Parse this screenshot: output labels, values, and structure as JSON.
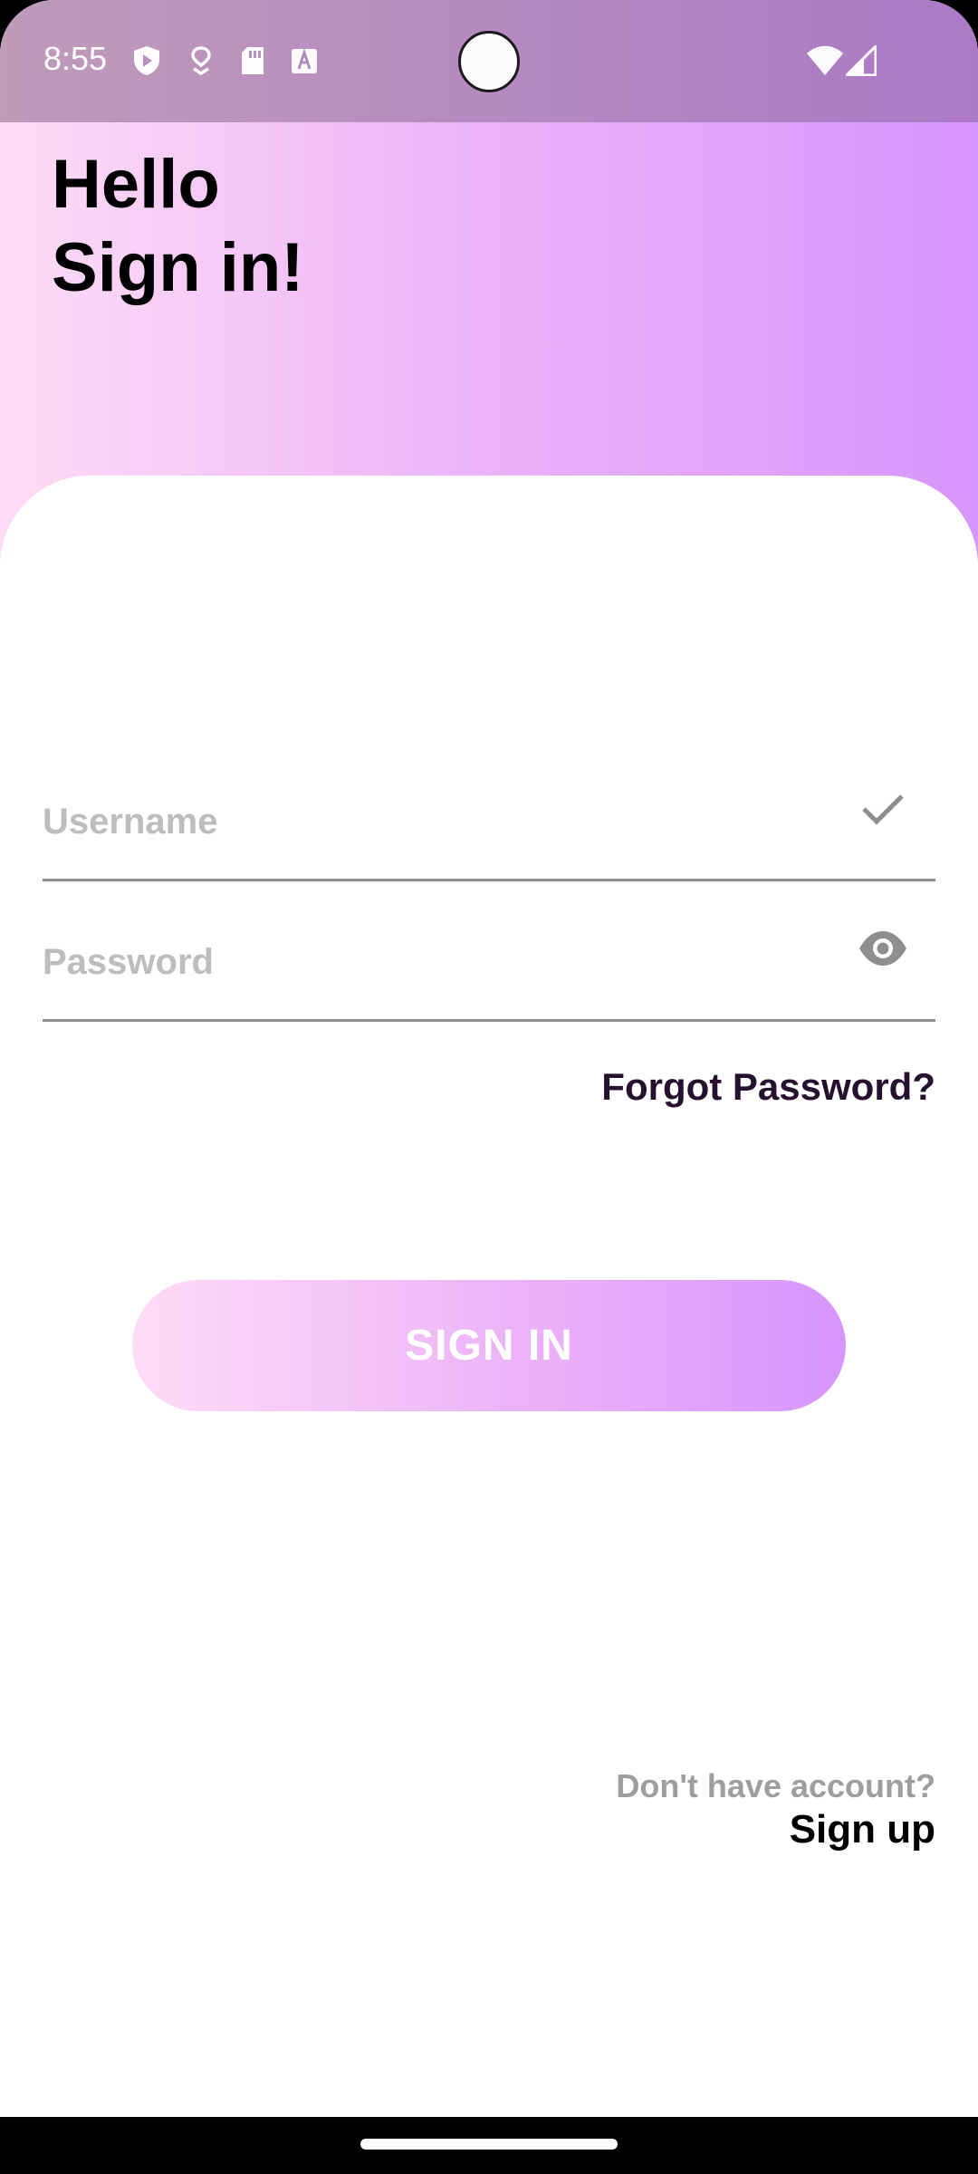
{
  "status_bar": {
    "time": "8:55",
    "icons": [
      "shield-icon",
      "location-icon",
      "sd-card-icon",
      "text-a-icon"
    ],
    "right_icons": [
      "wifi-icon",
      "signal-icon"
    ]
  },
  "header": {
    "line1": "Hello",
    "line2": "Sign in!"
  },
  "form": {
    "username_placeholder": "Username",
    "username_value": "",
    "password_placeholder": "Password",
    "password_value": "",
    "forgot_label": "Forgot Password?",
    "signin_label": "SIGN IN"
  },
  "footer": {
    "no_account_text": "Don't have account?",
    "signup_label": "Sign up"
  },
  "colors": {
    "gradient_start": "#ffdcf6",
    "gradient_end": "#d795fe",
    "primary_text": "#25112e",
    "muted_text": "#9e9e9e"
  }
}
